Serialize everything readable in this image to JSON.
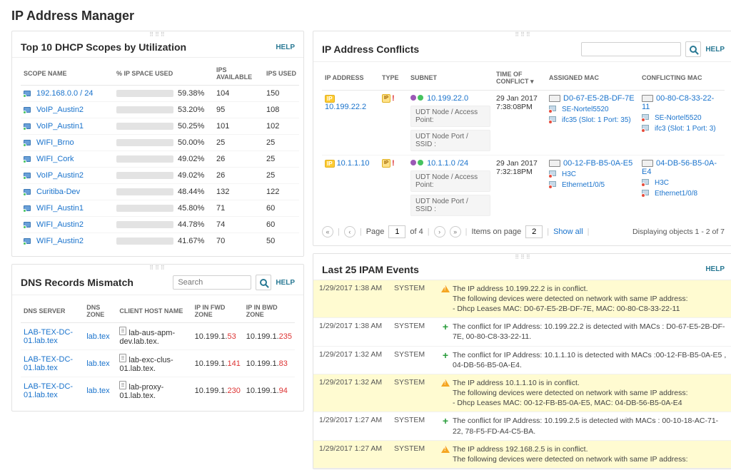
{
  "title": "IP Address Manager",
  "help_label": "HELP",
  "dhcp": {
    "title": "Top 10 DHCP Scopes by Utilization",
    "cols": [
      "SCOPE NAME",
      "% IP SPACE USED",
      "IPS AVAILABLE",
      "IPS USED"
    ],
    "rows": [
      {
        "name": "192.168.0.0 / 24",
        "pct": "59.38%",
        "avail": "104",
        "used": "150"
      },
      {
        "name": "VoIP_Austin2",
        "pct": "53.20%",
        "avail": "95",
        "used": "108"
      },
      {
        "name": "VoIP_Austin1",
        "pct": "50.25%",
        "avail": "101",
        "used": "102"
      },
      {
        "name": "WIFI_Brno",
        "pct": "50.00%",
        "avail": "25",
        "used": "25"
      },
      {
        "name": "WIFI_Cork",
        "pct": "49.02%",
        "avail": "26",
        "used": "25"
      },
      {
        "name": "VoIP_Austin2",
        "pct": "49.02%",
        "avail": "26",
        "used": "25"
      },
      {
        "name": "Curitiba-Dev",
        "pct": "48.44%",
        "avail": "132",
        "used": "122"
      },
      {
        "name": "WIFI_Austin1",
        "pct": "45.80%",
        "avail": "71",
        "used": "60"
      },
      {
        "name": "WIFI_Austin2",
        "pct": "44.78%",
        "avail": "74",
        "used": "60"
      },
      {
        "name": "WIFI_Austin2",
        "pct": "41.67%",
        "avail": "70",
        "used": "50"
      }
    ]
  },
  "dns": {
    "title": "DNS Records Mismatch",
    "search_placeholder": "Search",
    "cols": [
      "DNS SERVER",
      "DNS ZONE",
      "CLIENT HOST NAME",
      "IP IN FWD ZONE",
      "IP IN BWD ZONE"
    ],
    "rows": [
      {
        "server": "LAB-TEX-DC-01.lab.tex",
        "zone": "lab.tex",
        "host": "lab-aus-apm-dev.lab.tex.",
        "fwd_pre": "10.199.1.",
        "fwd_suf": "53",
        "bwd_pre": "10.199.1.",
        "bwd_suf": "235"
      },
      {
        "server": "LAB-TEX-DC-01.lab.tex",
        "zone": "lab.tex",
        "host": "lab-exc-clus-01.lab.tex.",
        "fwd_pre": "10.199.1.",
        "fwd_suf": "141",
        "bwd_pre": "10.199.1.",
        "bwd_suf": "83"
      },
      {
        "server": "LAB-TEX-DC-01.lab.tex",
        "zone": "lab.tex",
        "host": "lab-proxy-01.lab.tex.",
        "fwd_pre": "10.199.1.",
        "fwd_suf": "230",
        "bwd_pre": "10.199.1.",
        "bwd_suf": "94"
      }
    ]
  },
  "conflicts": {
    "title": "IP Address Conflicts",
    "cols": [
      "IP ADDRESS",
      "TYPE",
      "SUBNET",
      "TIME OF CONFLICT ▾",
      "ASSIGNED MAC",
      "CONFLICTING MAC"
    ],
    "subnet_sub1": "UDT Node / Access Point:",
    "subnet_sub2": "UDT Node Port / SSID :",
    "rows": [
      {
        "ip": "10.199.22.2",
        "subnet": "10.199.22.0",
        "time": "29 Jan 2017 7:38:08PM",
        "amac": "D0-67-E5-2B-DF-7E",
        "amac_node": "SE-Nortel5520",
        "amac_port": "ifc35 (Slot: 1 Port: 35)",
        "cmac": "00-80-C8-33-22-11",
        "cmac_node": "SE-Nortel5520",
        "cmac_port": "ifc3 (Slot: 1 Port: 3)"
      },
      {
        "ip": "10.1.1.10",
        "subnet": "10.1.1.0 /24",
        "time": "29 Jan 2017 7:32:18PM",
        "amac": "00-12-FB-B5-0A-E5",
        "amac_node": "H3C",
        "amac_port": "Ethernet1/0/5",
        "cmac": "04-DB-56-B5-0A-E4",
        "cmac_node": "H3C",
        "cmac_port": "Ethernet1/0/8"
      }
    ],
    "pager": {
      "page_label": "Page",
      "page": "1",
      "of": "of 4",
      "ipp_label": "Items on page",
      "ipp": "2",
      "show_all": "Show all",
      "right": "Displaying objects 1 - 2 of 7"
    }
  },
  "events": {
    "title": "Last 25 IPAM Events",
    "source": "SYSTEM",
    "rows": [
      {
        "warn": true,
        "time": "1/29/2017 1:38 AM",
        "msg": "The IP address 10.199.22.2 is in conflict.\nThe following devices were detected on network with same IP address:\n- Dhcp Leases MAC: D0-67-E5-2B-DF-7E, MAC: 00-80-C8-33-22-11"
      },
      {
        "warn": false,
        "time": "1/29/2017 1:38 AM",
        "msg": "The conflict for IP Address: 10.199.22.2 is detected with MACs : D0-67-E5-2B-DF-7E, 00-80-C8-33-22-11."
      },
      {
        "warn": false,
        "time": "1/29/2017 1:32 AM",
        "msg": "The conflict for IP Address: 10.1.1.10 is detected with MACs :00-12-FB-B5-0A-E5 , 04-DB-56-B5-0A-E4."
      },
      {
        "warn": true,
        "time": "1/29/2017 1:32 AM",
        "msg": "The IP address 10.1.1.10 is in conflict.\nThe following devices were detected on network with same IP address:\n- Dhcp Leases MAC: 00-12-FB-B5-0A-E5, MAC: 04-DB-56-B5-0A-E4"
      },
      {
        "warn": false,
        "time": "1/29/2017 1:27 AM",
        "msg": "The conflict for IP Address: 10.199.2.5 is detected with MACs : 00-10-18-AC-71-22, 78-F5-FD-A4-C5-BA."
      },
      {
        "warn": true,
        "time": "1/29/2017 1:27 AM",
        "msg": "The IP address 192.168.2.5 is in conflict.\nThe following devices were detected on network with same IP address:"
      }
    ]
  }
}
